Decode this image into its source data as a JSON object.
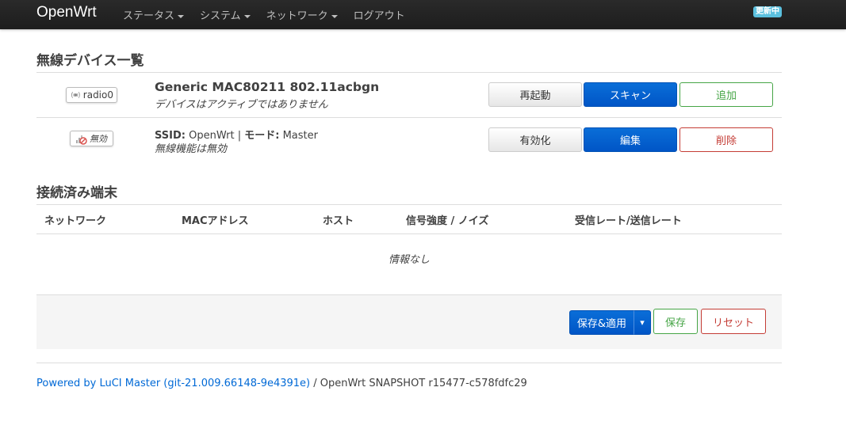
{
  "header": {
    "brand": "OpenWrt",
    "menu": [
      {
        "label": "ステータス",
        "dropdown": true
      },
      {
        "label": "システム",
        "dropdown": true
      },
      {
        "label": "ネットワーク",
        "dropdown": true
      },
      {
        "label": "ログアウト",
        "dropdown": false
      }
    ],
    "update_badge": "更新中"
  },
  "wireless": {
    "title": "無線デバイス一覧",
    "device": {
      "badge_label": "radio0",
      "name": "Generic MAC80211 802.11acbgn",
      "status": "デバイスはアクティブではありません",
      "buttons": {
        "restart": "再起動",
        "scan": "スキャン",
        "add": "追加"
      }
    },
    "network": {
      "badge_label": "無効",
      "ssid_label": "SSID:",
      "ssid_value": "OpenWrt",
      "separator": "|",
      "mode_label": "モード:",
      "mode_value": "Master",
      "status": "無線機能は無効",
      "buttons": {
        "enable": "有効化",
        "edit": "編集",
        "delete": "削除"
      }
    }
  },
  "clients": {
    "title": "接続済み端末",
    "columns": [
      "ネットワーク",
      "MACアドレス",
      "ホスト",
      "信号強度 / ノイズ",
      "受信レート/送信レート"
    ],
    "empty_text": "情報なし"
  },
  "actions": {
    "save_apply": "保存&適用",
    "dropdown_arrow": "▾",
    "save": "保存",
    "reset": "リセット"
  },
  "footer": {
    "link_text": "Powered by LuCI Master (git-21.009.66148-9e4391e)",
    "rest": " / OpenWrt SNAPSHOT r15477-c578fdfc29"
  },
  "colors": {
    "primary": "#0055c6",
    "success": "#46a546",
    "danger": "#c43c35",
    "navbar": "#222222"
  }
}
